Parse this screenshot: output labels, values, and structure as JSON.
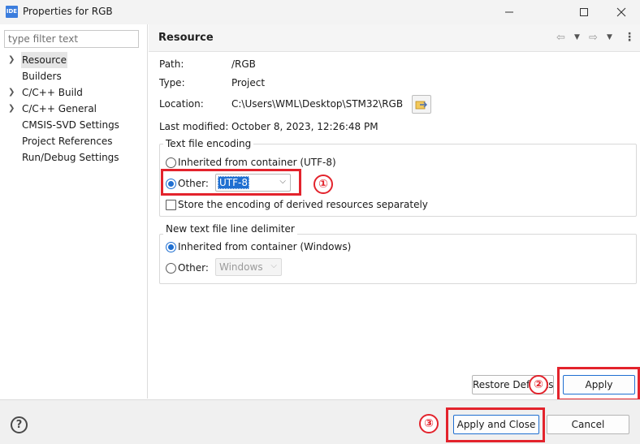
{
  "window": {
    "icon_text": "IDE",
    "title": "Properties for RGB"
  },
  "filter": {
    "placeholder": "type filter text"
  },
  "tree": [
    {
      "label": "Resource",
      "expandable": true,
      "selected": true
    },
    {
      "label": "Builders",
      "expandable": false
    },
    {
      "label": "C/C++ Build",
      "expandable": true
    },
    {
      "label": "C/C++ General",
      "expandable": true
    },
    {
      "label": "CMSIS-SVD Settings",
      "expandable": false
    },
    {
      "label": "Project References",
      "expandable": false
    },
    {
      "label": "Run/Debug Settings",
      "expandable": false
    }
  ],
  "page": {
    "title": "Resource",
    "path_label": "Path:",
    "path_value": "/RGB",
    "type_label": "Type:",
    "type_value": "Project",
    "location_label": "Location:",
    "location_value": "C:\\Users\\WML\\Desktop\\STM32\\RGB",
    "modified_label": "Last modified:",
    "modified_value": "October 8, 2023, 12:26:48 PM"
  },
  "encoding": {
    "group_title": "Text file encoding",
    "inherited_label": "Inherited from container (UTF-8)",
    "other_label": "Other:",
    "other_value": "UTF-8",
    "store_label": "Store the encoding of derived resources separately"
  },
  "delimiter": {
    "group_title": "New text file line delimiter",
    "inherited_label": "Inherited from container (Windows)",
    "other_label": "Other:",
    "other_value": "Windows"
  },
  "buttons": {
    "restore": "Restore Defaults",
    "apply": "Apply",
    "apply_close": "Apply and Close",
    "cancel": "Cancel"
  },
  "annotations": {
    "one": "①",
    "two": "②",
    "three": "③"
  },
  "colors": {
    "annotation": "#e3232c",
    "accent": "#1f6fd1"
  }
}
